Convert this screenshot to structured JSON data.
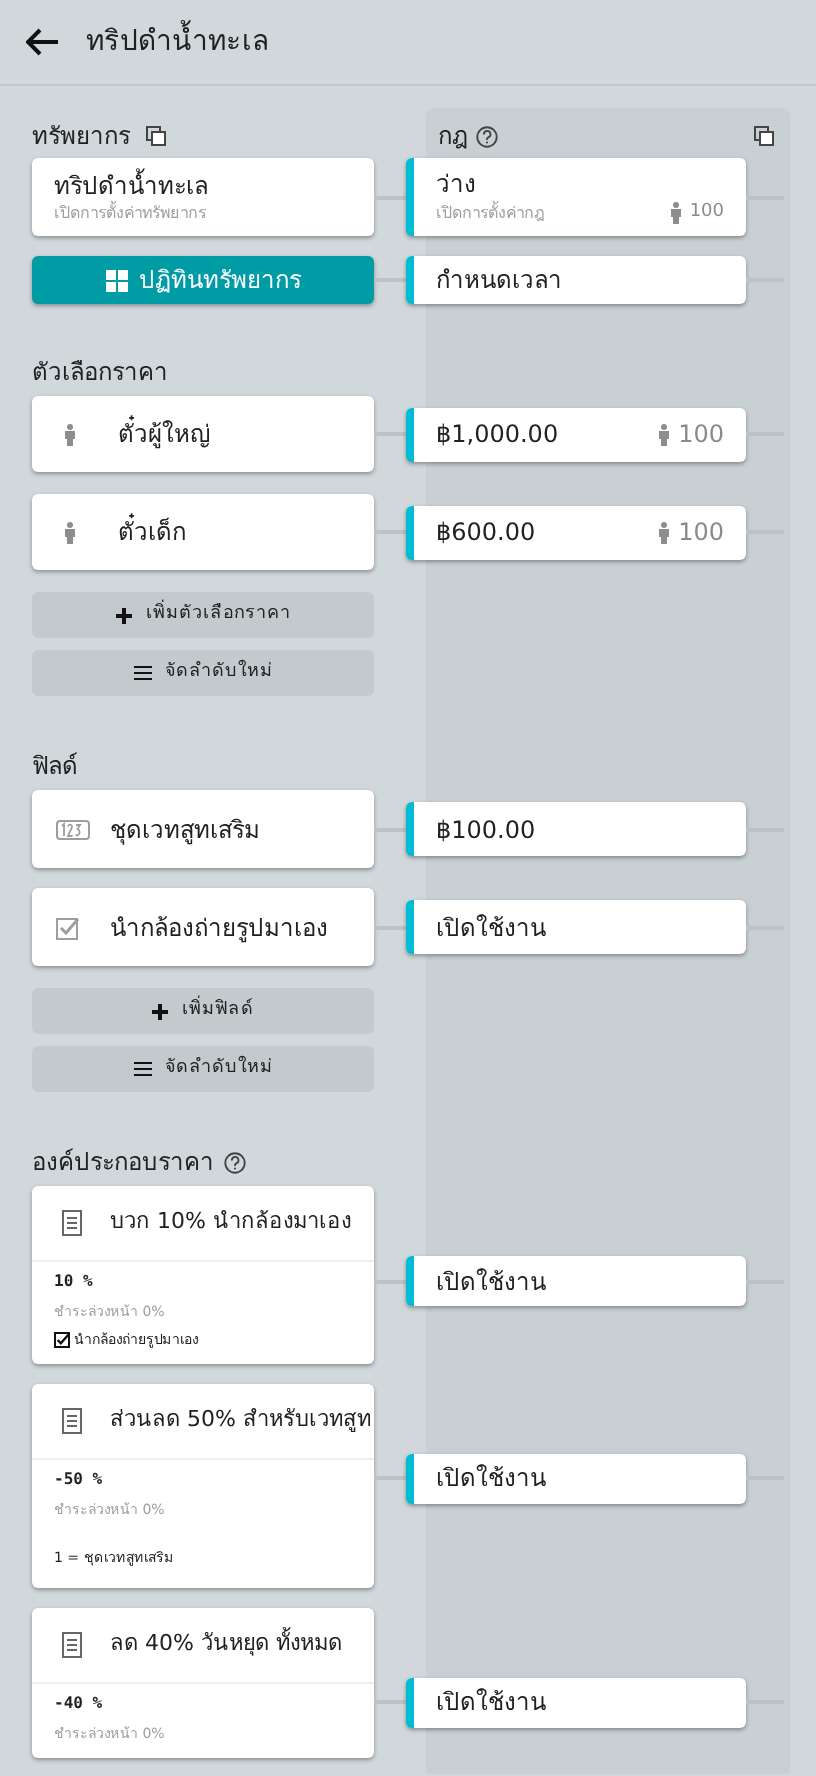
{
  "header": {
    "title": "ทริปดำน้ำทะเล"
  },
  "resources": {
    "title": "ทรัพยากร",
    "card": {
      "title": "ทริปดำน้ำทะเล",
      "subtitle": "เปิดการตั้งค่าทรัพยากร"
    },
    "calendar_button": "ปฏิทินทรัพยากร"
  },
  "rules": {
    "title": "กฎ",
    "resource_rule": {
      "title": "ว่าง",
      "subtitle": "เปิดการตั้งค่ากฎ",
      "count": "100"
    },
    "calendar_rule": "กำหนดเวลา"
  },
  "price_options": {
    "title": "ตัวเลือกราคา",
    "items": [
      {
        "label": "ตั๋วผู้ใหญ่",
        "rule": {
          "price": "฿1,000.00",
          "count": "100"
        }
      },
      {
        "label": "ตั๋วเด็ก",
        "rule": {
          "price": "฿600.00",
          "count": "100"
        }
      }
    ],
    "add_button": "เพิ่มตัวเลือกราคา",
    "reorder_button": "จัดลำดับใหม่"
  },
  "fields": {
    "title": "ฟิลด์",
    "items": [
      {
        "kind": "number",
        "label": "ชุดเวทสูทเสริม",
        "rule": "฿100.00"
      },
      {
        "kind": "checkbox",
        "label": "นำกล้องถ่ายรูปมาเอง",
        "rule": "เปิดใช้งาน"
      }
    ],
    "add_button": "เพิ่มฟิลด์",
    "reorder_button": "จัดลำดับใหม่"
  },
  "price_components": {
    "title": "องค์ประกอบราคา",
    "items": [
      {
        "title": "บวก 10% นำกล้องมาเอง",
        "amount": "10 %",
        "deposit": "ชำระล่วงหน้า 0%",
        "condition": {
          "kind": "checkbox",
          "text": "นำกล้องถ่ายรูปมาเอง"
        },
        "rule": "เปิดใช้งาน"
      },
      {
        "title": "ส่วนลด 50% สำหรับเวทสูท",
        "amount": "-50 %",
        "deposit": "ชำระล่วงหน้า 0%",
        "condition": {
          "kind": "quantity",
          "text": "1 = ชุดเวทสูทเสริม"
        },
        "rule": "เปิดใช้งาน"
      },
      {
        "title": "ลด 40% วันหยุด ทั้งหมด",
        "amount": "-40 %",
        "deposit": "ชำระล่วงหน้า 0%",
        "rule": "เปิดใช้งาน"
      }
    ]
  }
}
